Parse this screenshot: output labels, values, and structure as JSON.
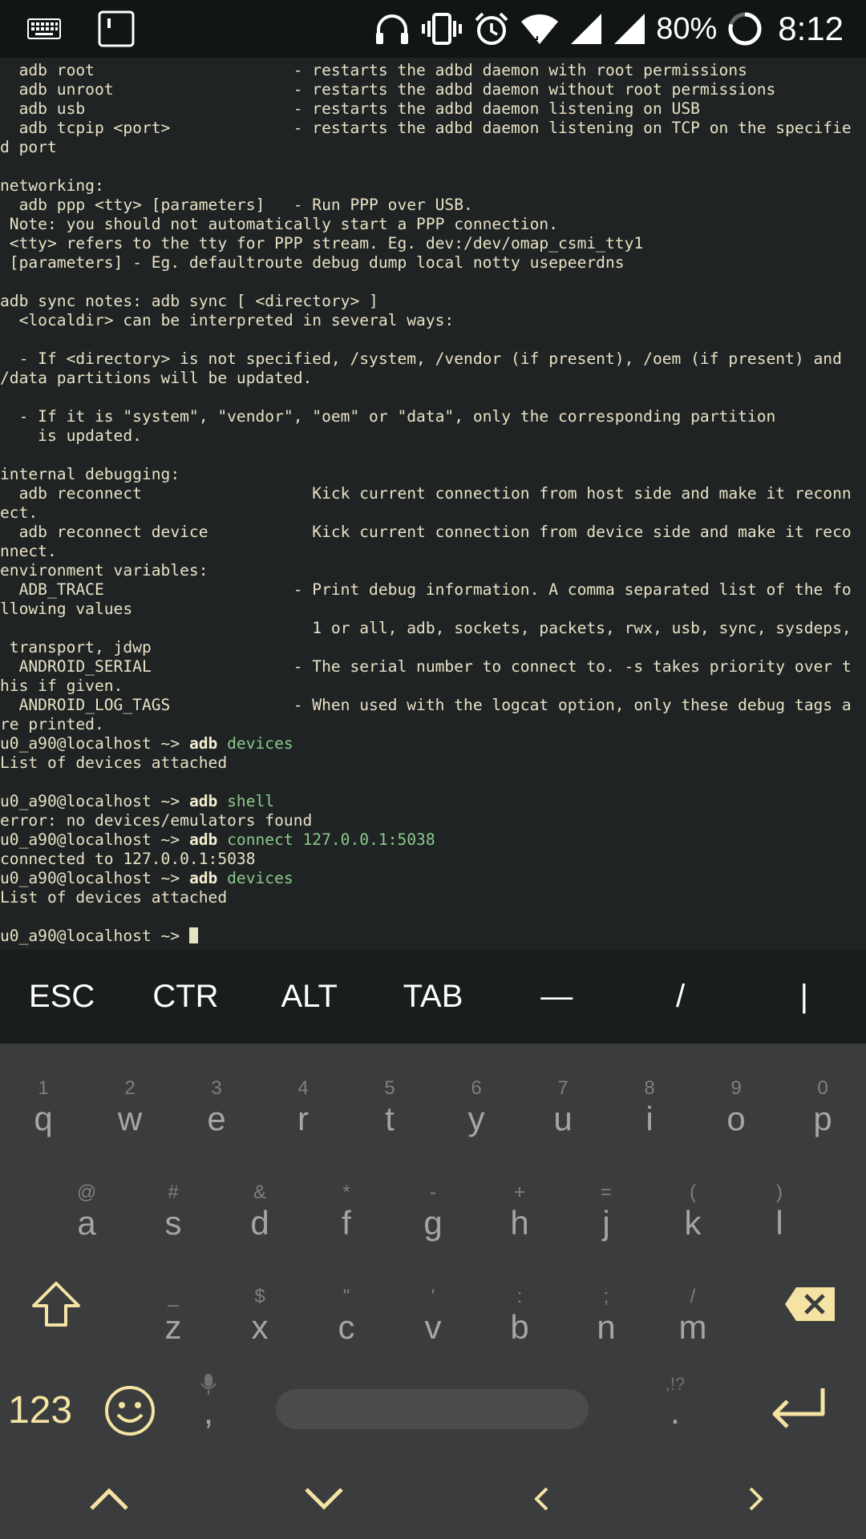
{
  "status_bar": {
    "battery": "80%",
    "time": "8:12",
    "icons": [
      "keyboard-icon",
      "terminal-app-icon",
      "headphones-icon",
      "vibrate-icon",
      "alarm-icon",
      "wifi-icon",
      "signal-icon",
      "signal-icon",
      "battery-icon"
    ]
  },
  "terminal": {
    "lines": [
      {
        "t": "  adb root                     - restarts the adbd daemon with root permissions"
      },
      {
        "t": "  adb unroot                   - restarts the adbd daemon without root permissions"
      },
      {
        "t": "  adb usb                      - restarts the adbd daemon listening on USB"
      },
      {
        "t": "  adb tcpip <port>             - restarts the adbd daemon listening on TCP on the specifie"
      },
      {
        "t": "d port"
      },
      {
        "t": ""
      },
      {
        "t": "networking:"
      },
      {
        "t": "  adb ppp <tty> [parameters]   - Run PPP over USB."
      },
      {
        "t": " Note: you should not automatically start a PPP connection."
      },
      {
        "t": " <tty> refers to the tty for PPP stream. Eg. dev:/dev/omap_csmi_tty1"
      },
      {
        "t": " [parameters] - Eg. defaultroute debug dump local notty usepeerdns"
      },
      {
        "t": ""
      },
      {
        "t": "adb sync notes: adb sync [ <directory> ]"
      },
      {
        "t": "  <localdir> can be interpreted in several ways:"
      },
      {
        "t": ""
      },
      {
        "t": "  - If <directory> is not specified, /system, /vendor (if present), /oem (if present) and"
      },
      {
        "t": "/data partitions will be updated."
      },
      {
        "t": ""
      },
      {
        "t": "  - If it is \"system\", \"vendor\", \"oem\" or \"data\", only the corresponding partition"
      },
      {
        "t": "    is updated."
      },
      {
        "t": ""
      },
      {
        "t": "internal debugging:"
      },
      {
        "t": "  adb reconnect                  Kick current connection from host side and make it reconn"
      },
      {
        "t": "ect."
      },
      {
        "t": "  adb reconnect device           Kick current connection from device side and make it reco"
      },
      {
        "t": "nnect."
      },
      {
        "t": "environment variables:"
      },
      {
        "t": "  ADB_TRACE                    - Print debug information. A comma separated list of the fo"
      },
      {
        "t": "llowing values"
      },
      {
        "t": "                                 1 or all, adb, sockets, packets, rwx, usb, sync, sysdeps,"
      },
      {
        "t": " transport, jdwp"
      },
      {
        "t": "  ANDROID_SERIAL               - The serial number to connect to. -s takes priority over t"
      },
      {
        "t": "his if given."
      },
      {
        "t": "  ANDROID_LOG_TAGS             - When used with the logcat option, only these debug tags a"
      },
      {
        "t": "re printed."
      },
      {
        "prompt": "u0_a90@localhost ~> ",
        "cmd": "adb",
        "arg": " devices"
      },
      {
        "t": "List of devices attached"
      },
      {
        "t": ""
      },
      {
        "prompt": "u0_a90@localhost ~> ",
        "cmd": "adb",
        "arg": " shell"
      },
      {
        "t": "error: no devices/emulators found"
      },
      {
        "prompt": "u0_a90@localhost ~> ",
        "cmd": "adb",
        "arg": " connect 127.0.0.1:5038"
      },
      {
        "t": "connected to 127.0.0.1:5038"
      },
      {
        "prompt": "u0_a90@localhost ~> ",
        "cmd": "adb",
        "arg": " devices"
      },
      {
        "t": "List of devices attached"
      },
      {
        "t": ""
      },
      {
        "prompt": "u0_a90@localhost ~> ",
        "cmd": "",
        "arg": "",
        "cursor": true
      }
    ]
  },
  "extra_keys": [
    "ESC",
    "CTR",
    "ALT",
    "TAB",
    "—",
    "/",
    "|"
  ],
  "keyboard": {
    "row1": [
      {
        "hint": "1",
        "key": "q"
      },
      {
        "hint": "2",
        "key": "w"
      },
      {
        "hint": "3",
        "key": "e"
      },
      {
        "hint": "4",
        "key": "r"
      },
      {
        "hint": "5",
        "key": "t"
      },
      {
        "hint": "6",
        "key": "y"
      },
      {
        "hint": "7",
        "key": "u"
      },
      {
        "hint": "8",
        "key": "i"
      },
      {
        "hint": "9",
        "key": "o"
      },
      {
        "hint": "0",
        "key": "p"
      }
    ],
    "row2": [
      {
        "hint": "@",
        "key": "a"
      },
      {
        "hint": "#",
        "key": "s"
      },
      {
        "hint": "&",
        "key": "d"
      },
      {
        "hint": "*",
        "key": "f"
      },
      {
        "hint": "-",
        "key": "g"
      },
      {
        "hint": "+",
        "key": "h"
      },
      {
        "hint": "=",
        "key": "j"
      },
      {
        "hint": "(",
        "key": "k"
      },
      {
        "hint": ")",
        "key": "l"
      }
    ],
    "row3": [
      {
        "hint": "_",
        "key": "z"
      },
      {
        "hint": "$",
        "key": "x"
      },
      {
        "hint": "\"",
        "key": "c"
      },
      {
        "hint": "'",
        "key": "v"
      },
      {
        "hint": ":",
        "key": "b"
      },
      {
        "hint": ";",
        "key": "n"
      },
      {
        "hint": "/",
        "key": "m"
      }
    ],
    "symbols_label": "123",
    "comma_key": ",",
    "period_key": ".",
    "period_hint": ",!?"
  },
  "colors": {
    "terminal_bg": "#1f2324",
    "terminal_text": "#e8e2c4",
    "command_arg": "#8bc98a",
    "keyboard_bg": "#3b3c3d",
    "accent_key": "#f4e3a2"
  }
}
